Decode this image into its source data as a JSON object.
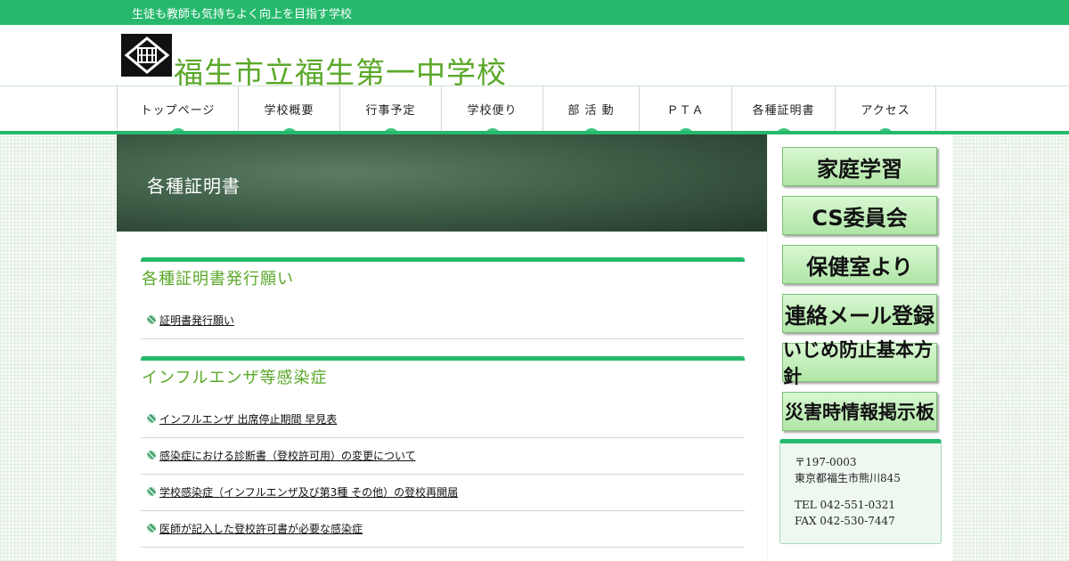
{
  "topbar": {
    "tagline": "生徒も教師も気持ちよく向上を目指す学校"
  },
  "header": {
    "site_title": "福生市立福生第一中学校"
  },
  "nav": {
    "items": [
      {
        "label": "トップページ"
      },
      {
        "label": "学校概要"
      },
      {
        "label": "行事予定"
      },
      {
        "label": "学校便り"
      },
      {
        "label": "部 活 動"
      },
      {
        "label": "ＰＴＡ"
      },
      {
        "label": "各種証明書"
      },
      {
        "label": "アクセス"
      }
    ]
  },
  "page": {
    "title": "各種証明書"
  },
  "sections": [
    {
      "title": "各種証明書発行願い",
      "items": [
        {
          "label": "証明書発行願い"
        }
      ]
    },
    {
      "title": "インフルエンザ等感染症",
      "items": [
        {
          "label": "インフルエンザ 出席停止期間 早見表"
        },
        {
          "label": "感染症における診断書（登校許可用）の変更について"
        },
        {
          "label": "学校感染症（インフルエンザ及び第3種 その他）の登校再開届"
        },
        {
          "label": "医師が記入した登校許可書が必要な感染症"
        }
      ]
    }
  ],
  "sidebar": {
    "buttons": [
      {
        "label": "家庭学習"
      },
      {
        "label": "CS委員会"
      },
      {
        "label": "保健室より"
      },
      {
        "label": "連絡メール登録"
      },
      {
        "label": "いじめ防止基本方針"
      },
      {
        "label": "災害時情報掲示板"
      }
    ],
    "address": {
      "postal": "〒197-0003",
      "street": "東京都福生市熊川845",
      "tel": "TEL 042-551-0321",
      "fax": "FAX 042-530-7447"
    }
  },
  "colors": {
    "accent": "#26b96c",
    "title_green": "#5aa829"
  }
}
